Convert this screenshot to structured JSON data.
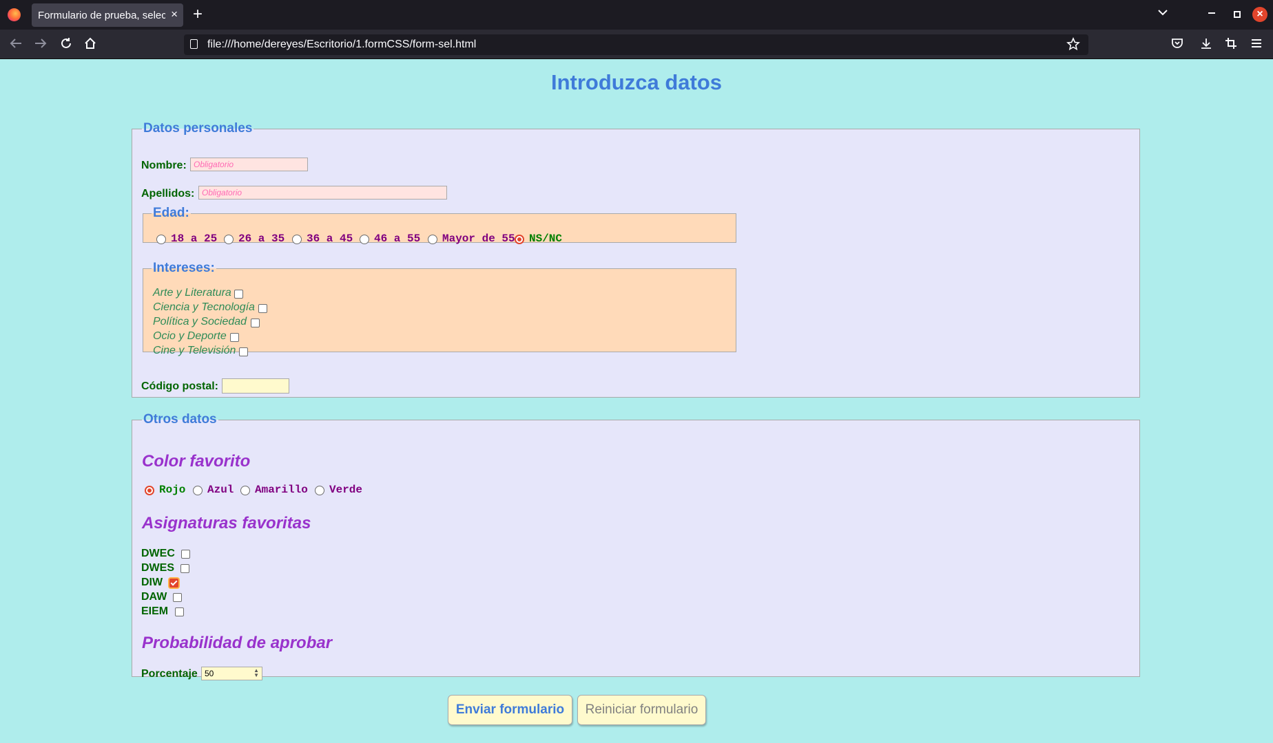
{
  "browser": {
    "tab_title": "Formulario de prueba, selecciones",
    "tab_close": "×",
    "new_tab": "+",
    "url": "file:///home/dereyes/Escritorio/1.formCSS/form-sel.html"
  },
  "page": {
    "title": "Introduzca datos"
  },
  "personal": {
    "legend": "Datos personales",
    "nombre_label": "Nombre:",
    "nombre_placeholder": "Obligatorio",
    "apellidos_label": "Apellidos:",
    "apellidos_placeholder": "Obligatorio",
    "edad": {
      "legend": "Edad:",
      "options": [
        "18 a 25",
        "26 a 35",
        "36 a 45",
        "46 a 55",
        "Mayor de 55",
        "NS/NC"
      ],
      "selected": "NS/NC"
    },
    "intereses": {
      "legend": "Intereses:",
      "items": [
        "Arte y Literatura",
        "Ciencia y Tecnología",
        "Política y Sociedad",
        "Ocio y Deporte",
        "Cine y Televisión"
      ]
    },
    "cp_label": "Código postal:",
    "cp_value": ""
  },
  "otros": {
    "legend": "Otros datos",
    "color_heading": "Color favorito",
    "colors": [
      "Rojo",
      "Azul",
      "Amarillo",
      "Verde"
    ],
    "color_selected": "Rojo",
    "asignaturas_heading": "Asignaturas favoritas",
    "asignaturas": [
      {
        "label": "DWEC",
        "checked": false
      },
      {
        "label": "DWES",
        "checked": false
      },
      {
        "label": "DIW",
        "checked": true
      },
      {
        "label": "DAW",
        "checked": false
      },
      {
        "label": "EIEM",
        "checked": false
      }
    ],
    "probabilidad_heading": "Probabilidad de aprobar",
    "porcentaje_label": "Porcentaje",
    "porcentaje_value": "50"
  },
  "buttons": {
    "submit": "Enviar formulario",
    "reset": "Reiniciar formulario"
  },
  "colors": {
    "page_bg": "#afedec",
    "fieldset_bg": "#e6e6fa",
    "inner_bg": "#ffdab9",
    "accent": "#3f7bd9",
    "radio_checked": "#e2452c"
  }
}
